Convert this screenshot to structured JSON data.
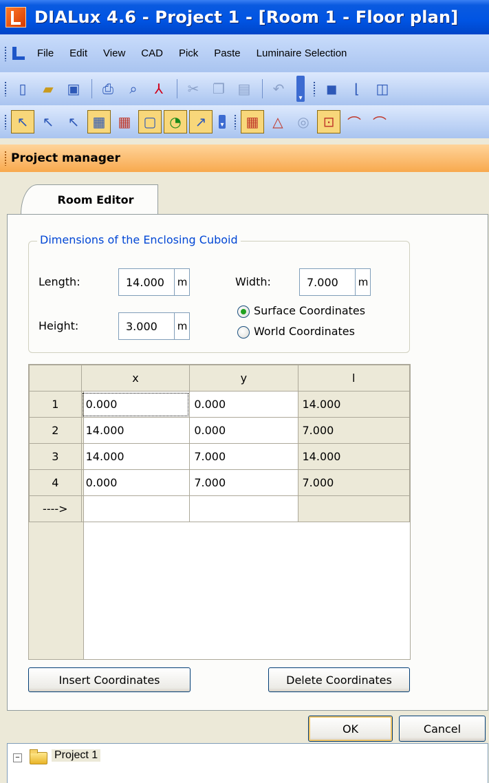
{
  "window": {
    "title": "DIALux 4.6 - Project 1 - [Room 1 - Floor plan]"
  },
  "menu": {
    "items": [
      "File",
      "Edit",
      "View",
      "CAD",
      "Pick",
      "Paste",
      "Luminaire Selection"
    ]
  },
  "project_manager": {
    "title": "Project manager"
  },
  "room_editor": {
    "tab_label": "Room Editor",
    "group_title": "Dimensions of the Enclosing Cuboid",
    "length_label": "Length:",
    "length_value": "14.000",
    "width_label": "Width:",
    "width_value": "7.000",
    "height_label": "Height:",
    "height_value": "3.000",
    "unit": "m",
    "radio_surface": "Surface Coordinates",
    "radio_world": "World Coordinates",
    "radio_selected": "surface",
    "table": {
      "headers": [
        "",
        "x",
        "y",
        "l"
      ],
      "rows": [
        {
          "idx": "1",
          "x": "0.000",
          "y": "0.000",
          "l": "14.000"
        },
        {
          "idx": "2",
          "x": "14.000",
          "y": "0.000",
          "l": "7.000"
        },
        {
          "idx": "3",
          "x": "14.000",
          "y": "7.000",
          "l": "14.000"
        },
        {
          "idx": "4",
          "x": "0.000",
          "y": "7.000",
          "l": "7.000"
        }
      ],
      "new_row_marker": "---->"
    },
    "insert_button": "Insert Coordinates",
    "delete_button": "Delete Coordinates",
    "ok_button": "OK",
    "cancel_button": "Cancel"
  },
  "tree": {
    "root_label": "Project 1"
  },
  "colors": {
    "title_bar": "#0054e3",
    "accent_orange": "#f8a94e",
    "group_title": "#0046d5"
  }
}
